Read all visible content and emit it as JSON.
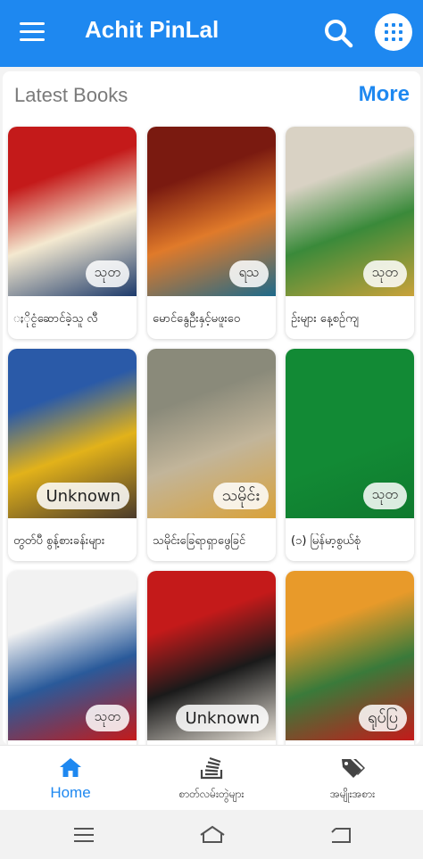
{
  "appbar": {
    "title": "Achit PinLal",
    "color": "#1e88f0"
  },
  "section": {
    "title": "Latest Books",
    "more_label": "More"
  },
  "books": [
    {
      "title": "ႏိုင္ငံဆောင်ခဲ့သူ    လီ",
      "badge": "သုတ",
      "cover_colors": [
        "#c41a1a",
        "#f4e9d0",
        "#1d3a6b"
      ]
    },
    {
      "title": "မောင်နွေဦးနှင့်မဖူးဝေ",
      "badge": "ရသ",
      "cover_colors": [
        "#7a1a10",
        "#e07a2a",
        "#1e6a8a"
      ]
    },
    {
      "title": "ဥ်းများ      နေ့စဉ်ကျ",
      "badge": "သုတ",
      "cover_colors": [
        "#d9d2c4",
        "#3a8a3a",
        "#c9a23a"
      ]
    },
    {
      "title": "တွတ်ပီ စွန့်စားခန်းများ",
      "badge": "Unknown",
      "cover_colors": [
        "#2a5aa8",
        "#e2b21a",
        "#4a3a2a"
      ]
    },
    {
      "title": "သမိုင်းခြေရာရှာဖွေခြင်",
      "badge": "သမိုင်း",
      "cover_colors": [
        "#8a8a7a",
        "#c2b59a",
        "#d9a23a"
      ]
    },
    {
      "title": "(၁)      မြန်မာ့စွယ်စုံ",
      "badge": "သုတ",
      "cover_colors": [
        "#128a35",
        "#128a35",
        "#0f7a2e"
      ]
    },
    {
      "title": "",
      "badge": "သုတ",
      "cover_colors": [
        "#f2f2f2",
        "#2a5a9a",
        "#c41a1a"
      ]
    },
    {
      "title": "",
      "badge": "Unknown",
      "cover_colors": [
        "#c41a1a",
        "#1a1a1a",
        "#e8e2d8"
      ]
    },
    {
      "title": "",
      "badge": "ရုပ်ပြ",
      "cover_colors": [
        "#e89a2a",
        "#3a7a3a",
        "#c41a1a"
      ]
    }
  ],
  "nav": {
    "items": [
      {
        "label": "Home",
        "icon": "home-icon",
        "active": true
      },
      {
        "label": "စာတ်လမ်းတွဲများ",
        "icon": "stacked-books-icon",
        "active": false
      },
      {
        "label": "အမျိုးအစား",
        "icon": "tags-icon",
        "active": false
      }
    ]
  },
  "system_bar": {
    "buttons": [
      "recents-icon",
      "home-outline-icon",
      "back-icon"
    ]
  }
}
